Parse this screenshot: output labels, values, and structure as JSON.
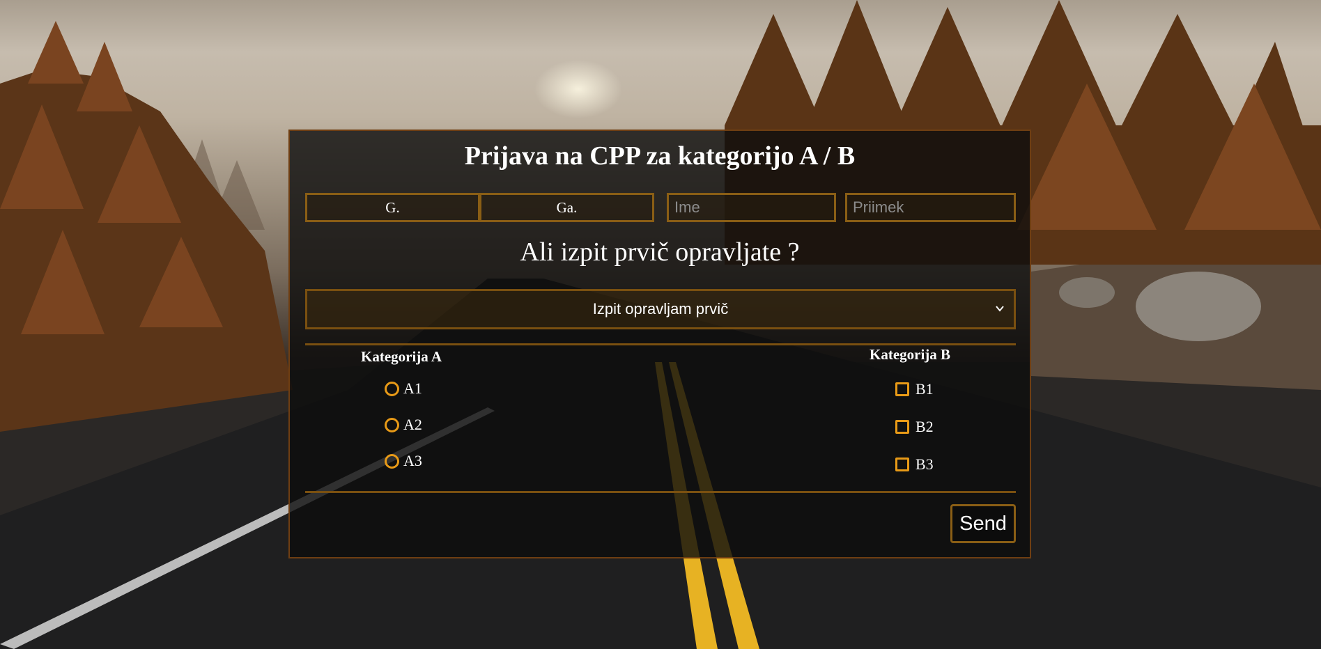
{
  "form": {
    "title": "Prijava na CPP za kategorijo A / B",
    "salutation_options": [
      "G.",
      "Ga."
    ],
    "first_name_placeholder": "Ime",
    "last_name_placeholder": "Priimek",
    "question": "Ali izpit prvič opravljate ?",
    "exam_select_value": "Izpit opravljam prvič",
    "category_a": {
      "title": "Kategorija A",
      "options": [
        "A1",
        "A2",
        "A3"
      ]
    },
    "category_b": {
      "title": "Kategorija B",
      "options": [
        "B1",
        "B2",
        "B3"
      ]
    },
    "send_label": "Send"
  },
  "colors": {
    "accent": "#e89a17",
    "border": "#8a5e15",
    "panel_bg": "#0c0c0c"
  }
}
